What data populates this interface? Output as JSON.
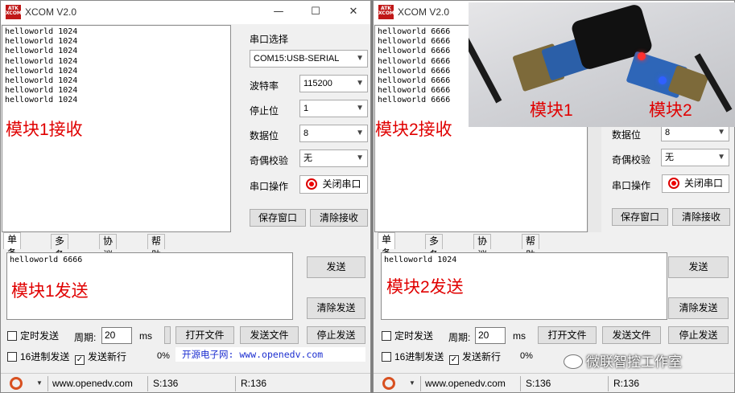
{
  "window_title": "XCOM V2.0",
  "logo_text": "ATK XCOM",
  "window_buttons": {
    "minimize": "—",
    "maximize": "☐",
    "close": "✕"
  },
  "left": {
    "recv_lines": [
      "helloworld 1024",
      "helloworld 1024",
      "helloworld 1024",
      "helloworld 1024",
      "helloworld 1024",
      "helloworld 1024",
      "helloworld 1024",
      "helloworld 1024"
    ],
    "settings": {
      "port_label": "串口选择",
      "port_value": "COM15:USB-SERIAL",
      "baud_label": "波特率",
      "baud_value": "115200",
      "stopbit_label": "停止位",
      "stopbit_value": "1",
      "databit_label": "数据位",
      "databit_value": "8",
      "parity_label": "奇偶校验",
      "parity_value": "无",
      "op_label": "串口操作",
      "close_port": "关闭串口",
      "save_window": "保存窗口",
      "clear_recv": "清除接收"
    },
    "tabs": [
      "单条发送",
      "多条发送",
      "协议传输",
      "帮助"
    ],
    "send_text": "helloworld 6666",
    "send_button": "发送",
    "clear_send": "清除发送",
    "timed_send": "定时发送",
    "period_label": "周期:",
    "period_value": "20",
    "period_unit": "ms",
    "open_file": "打开文件",
    "send_file": "发送文件",
    "stop_send": "停止发送",
    "hex_send": "16进制发送",
    "send_newline": "发送新行",
    "newline_check": "✓",
    "percent": "0%",
    "promo": "开源电子网: www.openedv.com",
    "status_url": "www.openedv.com",
    "status_s": "S:136",
    "status_r": "R:136",
    "annotation_recv": "模块1接收",
    "annotation_send": "模块1发送"
  },
  "right": {
    "recv_lines": [
      "helloworld 6666",
      "helloworld 6666",
      "helloworld 6666",
      "helloworld 6666",
      "helloworld 6666",
      "helloworld 6666",
      "helloworld 6666",
      "helloworld 6666"
    ],
    "settings": {
      "databit_label": "数据位",
      "databit_value": "8",
      "parity_label": "奇偶校验",
      "parity_value": "无",
      "op_label": "串口操作",
      "close_port": "关闭串口",
      "save_window": "保存窗口",
      "clear_recv": "清除接收"
    },
    "tabs": [
      "单条发送",
      "多条发送",
      "协议传输",
      "帮助"
    ],
    "send_text": "helloworld 1024",
    "send_button": "发送",
    "clear_send": "清除发送",
    "timed_send": "定时发送",
    "period_label": "周期:",
    "period_value": "20",
    "period_unit": "ms",
    "open_file": "打开文件",
    "send_file": "发送文件",
    "stop_send": "停止发送",
    "hex_send": "16进制发送",
    "send_newline": "发送新行",
    "newline_check": "✓",
    "percent": "0%",
    "status_url": "www.openedv.com",
    "status_s": "S:136",
    "status_r": "R:136",
    "annotation_recv": "模块2接收",
    "annotation_send": "模块2发送"
  },
  "photo": {
    "label_module1": "模块1",
    "label_module2": "模块2"
  },
  "watermark": "微联智控工作室",
  "colors": {
    "annotation": "#e00000",
    "promo": "#1d2fd0",
    "led": "#e00000"
  }
}
